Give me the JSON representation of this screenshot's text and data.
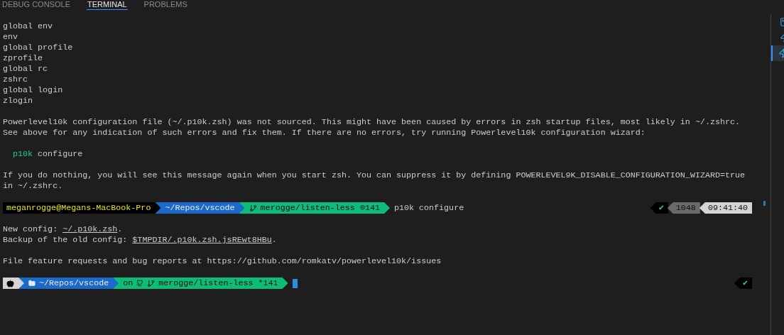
{
  "tabs": [
    {
      "label": "DEBUG CONSOLE",
      "selected": false
    },
    {
      "label": "TERMINAL",
      "selected": true
    },
    {
      "label": "PROBLEMS",
      "selected": false
    }
  ],
  "terminal": {
    "lines": [
      {
        "kind": "output",
        "text": "global env"
      },
      {
        "kind": "output",
        "text": "env"
      },
      {
        "kind": "output",
        "text": "global profile"
      },
      {
        "kind": "output",
        "text": "zprofile"
      },
      {
        "kind": "output",
        "text": "global rc"
      },
      {
        "kind": "output",
        "text": "zshrc"
      },
      {
        "kind": "output",
        "text": "global login"
      },
      {
        "kind": "output",
        "text": "zlogin"
      },
      {
        "kind": "blank"
      },
      {
        "kind": "output",
        "text": "Powerlevel10k configuration file (~/.p10k.zsh) was not sourced. This might have been caused by errors in zsh startup files, most likely in ~/.zshrc."
      },
      {
        "kind": "output",
        "text": "See above for any indication of such errors and fix them. If there are no errors, try running Powerlevel10k configuration wizard:"
      },
      {
        "kind": "blank"
      },
      {
        "kind": "command",
        "name": "p10k",
        "args": "configure"
      },
      {
        "kind": "blank"
      },
      {
        "kind": "output",
        "text": "If you do nothing, you will see this message again when you start zsh. You can suppress it by defining POWERLEVEL9K_DISABLE_CONFIGURATION_WIZARD=true"
      },
      {
        "kind": "output",
        "text": "in ~/.zshrc."
      },
      {
        "kind": "blank"
      },
      {
        "kind": "prompt",
        "segments": [
          {
            "kind": "user",
            "text": "meganrogge@Megans-MacBook-Pro"
          },
          {
            "kind": "dir",
            "text": "~/Repos/vscode"
          },
          {
            "kind": "git",
            "text": "merogge/listen-less ⊙141"
          }
        ],
        "input": "p10k configure",
        "right": [
          {
            "kind": "status",
            "text": "✔"
          },
          {
            "kind": "count",
            "text": "1048"
          },
          {
            "kind": "time",
            "text": "09:41:40"
          }
        ]
      },
      {
        "kind": "blank"
      },
      {
        "kind": "link",
        "prefix": "New config: ",
        "link": "~/.p10k.zsh",
        "suffix": "."
      },
      {
        "kind": "link",
        "prefix": "Backup of the old config: ",
        "link": "$TMPDIR/.p10k.zsh.jsREwt8HBu",
        "suffix": "."
      },
      {
        "kind": "blank"
      },
      {
        "kind": "output",
        "text": "File feature requests and bug reports at https://github.com/romkatv/powerlevel10k/issues"
      },
      {
        "kind": "blank"
      },
      {
        "kind": "prompt",
        "segments": [
          {
            "kind": "os"
          },
          {
            "kind": "dir_folder",
            "text": "~/Repos/vscode"
          },
          {
            "kind": "git_hosted",
            "lead": "on",
            "text": "merogge/listen-less *141"
          }
        ],
        "cursor": true,
        "right": [
          {
            "kind": "status",
            "text": "✔"
          }
        ]
      }
    ]
  },
  "side_panel": {
    "items": [
      {
        "kind": "terminal",
        "selected": false
      },
      {
        "kind": "task",
        "selected": false
      },
      {
        "kind": "task",
        "selected": true
      }
    ]
  }
}
